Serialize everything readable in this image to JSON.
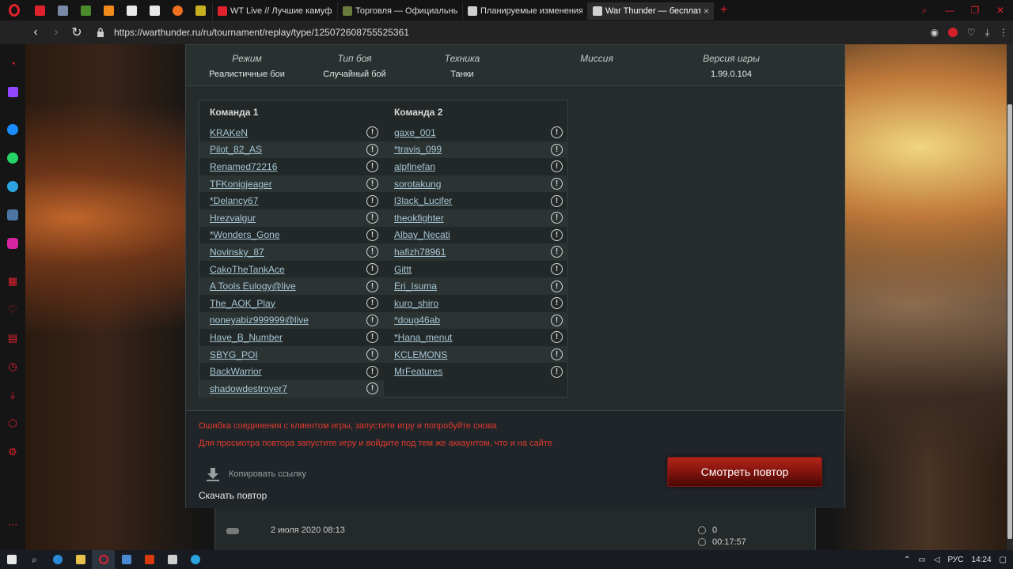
{
  "browser": {
    "tabs": [
      {
        "title": "WT Live // Лучшие камуфляжи",
        "favicon_color": "#e0212e",
        "active": false
      },
      {
        "title": "Торговля — Официальный",
        "favicon_color": "#6a7a3a",
        "active": false
      },
      {
        "title": "Планируемые изменения",
        "favicon_color": "#cfcfcf",
        "active": false
      },
      {
        "title": "War Thunder — бесплатная",
        "favicon_color": "#cfcfcf",
        "active": true
      }
    ],
    "tab_close": "×",
    "new_tab": "+",
    "url": "https://warthunder.ru/ru/tournament/replay/type/125072608755525361",
    "back": "‹",
    "forward": "›",
    "reload": "↻"
  },
  "match_info": {
    "columns": [
      {
        "header": "Режим",
        "value": "Реалистичные бои"
      },
      {
        "header": "Тип боя",
        "value": "Случайный бой"
      },
      {
        "header": "Техника",
        "value": "Танки"
      },
      {
        "header": "Миссия",
        "value": ""
      },
      {
        "header": "Версия игры",
        "value": "1.99.0.104"
      }
    ]
  },
  "teams": {
    "team1": {
      "title": "Команда 1",
      "players": [
        "KRAKeN",
        "Pilot_82_AS",
        "Renamed72216",
        "TFKonigjeager",
        "*Delancy67",
        "Hrezvalgur",
        "*Wonders_Gone",
        "Novinsky_87",
        "CakoTheTankAce",
        "A Tools Eulogy@live",
        "The_AOK_Play",
        "noneyabiz999999@live",
        "Have_B_Number",
        "SBYG_POI",
        "BackWarrior",
        "shadowdestroyer7"
      ]
    },
    "team2": {
      "title": "Команда 2",
      "players": [
        "gaxe_001",
        "*travis_099",
        "alpfinefan",
        "sorotakung",
        "l3lack_Lucifer",
        "theokfighter",
        "Albay_Necati",
        "hafizh78961",
        "Gittt",
        "Eri_Isuma",
        "kuro_shiro",
        "*doug46ab",
        "*Hana_menut",
        "KCLEMONS",
        "MrFeatures"
      ]
    },
    "warn_symbol": "!"
  },
  "footer": {
    "error1": "Ошибка соединения с клиентом игры, запустите игру и попробуйте снова",
    "error2": "Для просмотра повтора запустите игру и войдите под тем же аккаунтом, что и на сайте",
    "copy_link": "Копировать ссылку",
    "download_replay": "Скачать повтор",
    "watch_replay": "Смотреть повтор",
    "error_color": "#e03a2c"
  },
  "below_card": {
    "date": "2 июля 2020 08:13",
    "views": "0",
    "duration": "00:17:57"
  },
  "taskbar": {
    "lang": "РУС",
    "time": "14:24"
  }
}
